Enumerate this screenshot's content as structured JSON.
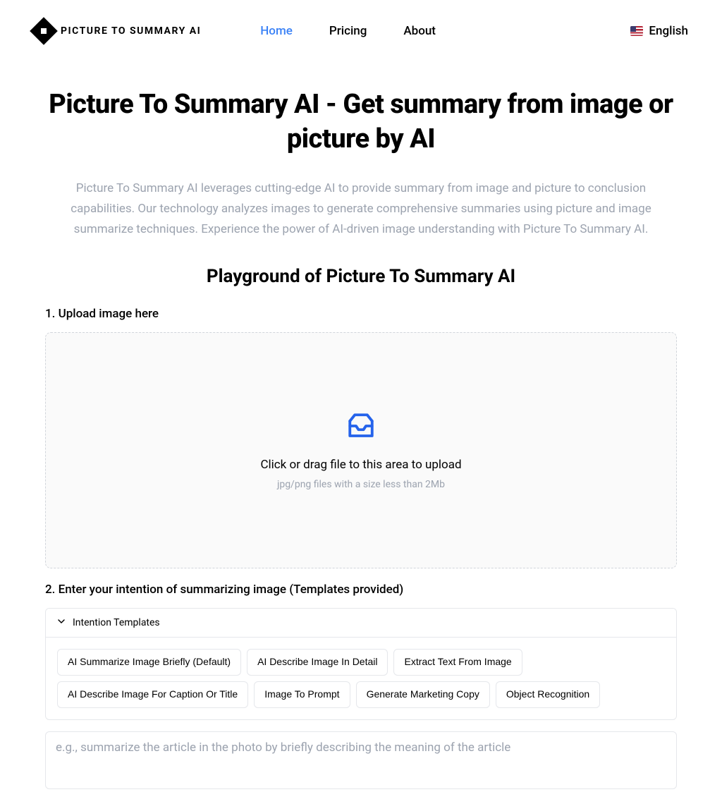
{
  "header": {
    "logo_text": "PICTURE TO SUMMARY AI",
    "nav": {
      "home": "Home",
      "pricing": "Pricing",
      "about": "About"
    },
    "lang": "English"
  },
  "main": {
    "title": "Picture To Summary AI - Get summary from image or picture by AI",
    "desc": "Picture To Summary AI leverages cutting-edge AI to provide summary from image and picture to conclusion capabilities. Our technology analyzes images to generate comprehensive summaries using picture and image summarize techniques. Experience the power of AI-driven image understanding with Picture To Summary AI.",
    "playground_title": "Playground of Picture To Summary AI",
    "step1_label": "1. Upload image here",
    "upload_main": "Click or drag file to this area to upload",
    "upload_hint": "jpg/png files with a size less than 2Mb",
    "step2_label": "2. Enter your intention of summarizing image (Templates provided)",
    "collapse_label": "Intention Templates",
    "templates": {
      "t0": "AI Summarize Image Briefly (Default)",
      "t1": "AI Describe Image In Detail",
      "t2": "Extract Text From Image",
      "t3": "AI Describe Image For Caption Or Title",
      "t4": "Image To Prompt",
      "t5": "Generate Marketing Copy",
      "t6": "Object Recognition"
    },
    "intent_placeholder": "e.g., summarize the article in the photo by briefly describing the meaning of the article"
  }
}
